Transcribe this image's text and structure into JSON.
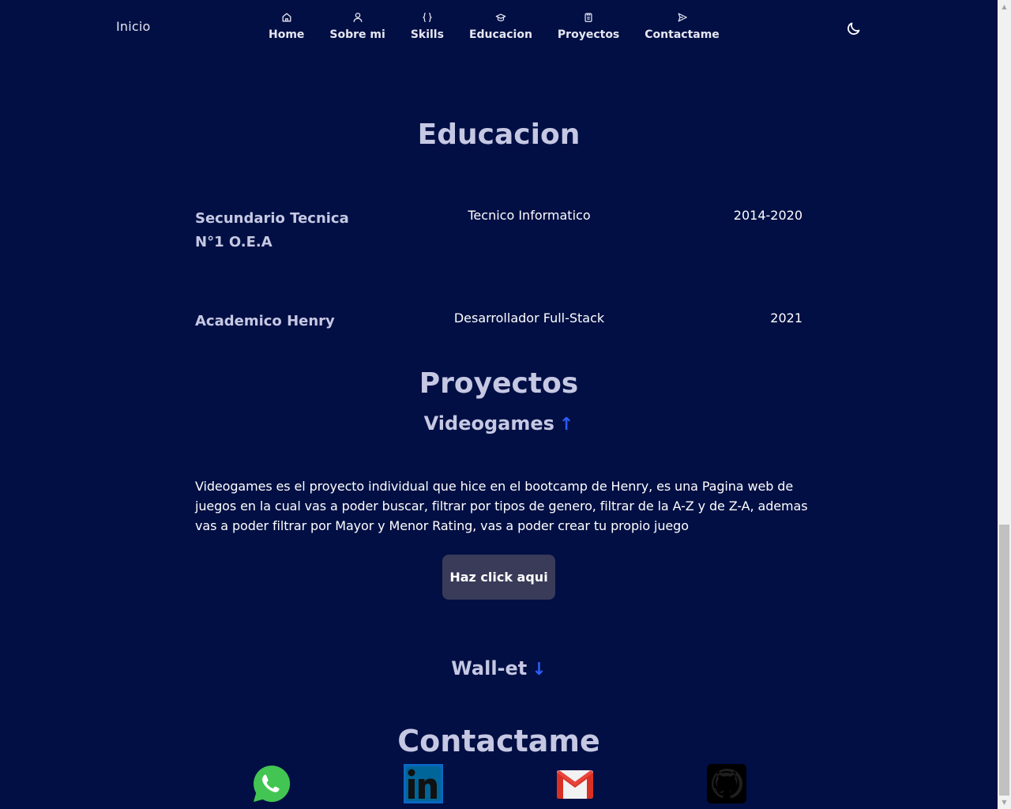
{
  "header": {
    "logo": "Inicio",
    "nav": [
      {
        "label": "Home",
        "icon": "home-icon"
      },
      {
        "label": "Sobre mi",
        "icon": "user-icon"
      },
      {
        "label": "Skills",
        "icon": "braces-icon"
      },
      {
        "label": "Educacion",
        "icon": "graduation-cap-icon"
      },
      {
        "label": "Proyectos",
        "icon": "clipboard-icon"
      },
      {
        "label": "Contactame",
        "icon": "send-icon"
      }
    ],
    "theme_icon": "moon-icon"
  },
  "education": {
    "title": "Educacion",
    "items": [
      {
        "school": "Secundario Tecnica N°1 O.E.A",
        "degree": "Tecnico Informatico",
        "years": "2014-2020"
      },
      {
        "school": "Academico Henry",
        "degree": "Desarrollador Full-Stack",
        "years": "2021"
      }
    ]
  },
  "projects": {
    "title": "Proyectos",
    "items": [
      {
        "name": "Videogames",
        "arrow": "↑",
        "expanded": true,
        "description": "Videogames es el proyecto individual que hice en el bootcamp de Henry, es una Pagina web de juegos en la cual vas a poder buscar, filtrar por tipos de genero, filtrar de la A-Z y de Z-A, ademas vas a poder filtrar por Mayor y Menor Rating, vas a poder crear tu propio juego",
        "button": "Haz click aqui"
      },
      {
        "name": "Wall-et",
        "arrow": "↓",
        "expanded": false
      }
    ]
  },
  "contact": {
    "title": "Contactame",
    "links": [
      {
        "name": "whatsapp-icon"
      },
      {
        "name": "linkedin-icon"
      },
      {
        "name": "gmail-icon"
      },
      {
        "name": "github-icon"
      }
    ]
  },
  "colors": {
    "background": "#010f44",
    "heading": "#c6c8e3",
    "accent": "#2d5cf6",
    "button": "#393b58"
  }
}
